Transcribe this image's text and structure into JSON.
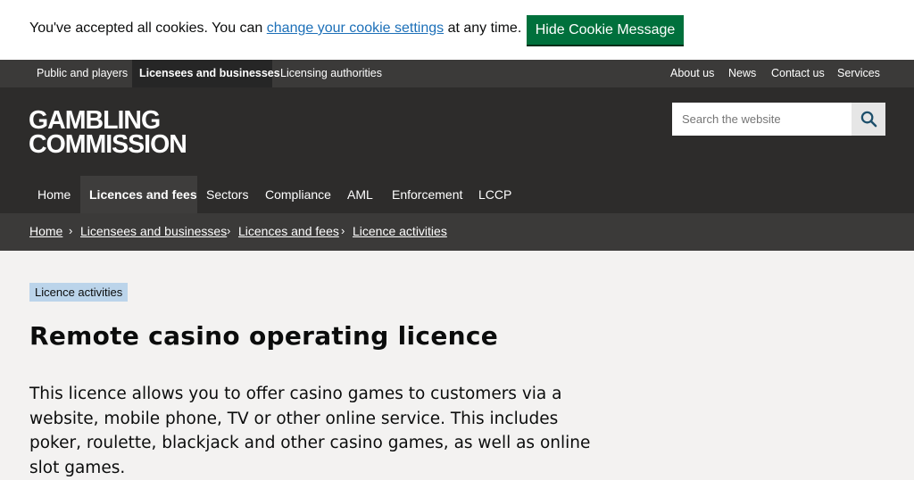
{
  "cookie": {
    "text_before": "You've accepted all cookies. You can ",
    "link_text": "change your cookie settings",
    "text_after": " at any time.",
    "button_label": "Hide Cookie Message"
  },
  "audience_nav": {
    "items": [
      {
        "label": "Public and players",
        "active": false
      },
      {
        "label": "Licensees and businesses",
        "active": true
      },
      {
        "label": "Licensing authorities",
        "active": false
      }
    ],
    "right_items": [
      {
        "label": "About us"
      },
      {
        "label": "News"
      },
      {
        "label": "Contact us"
      },
      {
        "label": "Services"
      }
    ]
  },
  "header": {
    "logo_line1": "GAMBLING",
    "logo_line2": "COMMISSION",
    "search_placeholder": "Search the website",
    "search_icon": "search-icon"
  },
  "main_nav": {
    "items": [
      {
        "label": "Home",
        "active": false
      },
      {
        "label": "Licences and fees",
        "active": true
      },
      {
        "label": "Sectors",
        "active": false
      },
      {
        "label": "Compliance",
        "active": false
      },
      {
        "label": "AML",
        "active": false
      },
      {
        "label": "Enforcement",
        "active": false
      },
      {
        "label": "LCCP",
        "active": false
      }
    ]
  },
  "breadcrumb": {
    "items": [
      {
        "label": "Home"
      },
      {
        "label": "Licensees and businesses"
      },
      {
        "label": "Licences and fees"
      },
      {
        "label": "Licence activities"
      }
    ],
    "separator": "›"
  },
  "content": {
    "tag": "Licence activities",
    "title": "Remote casino operating licence",
    "lead": "This licence allows you to offer casino games to customers via a website, mobile phone, TV or other online service. This includes poker, roulette, blackjack and other casino games, as well as online slot games."
  },
  "colors": {
    "cookie_button": "#00703c",
    "link": "#1d70b8",
    "header_bg": "#2d2c2b",
    "bar_bg": "#3b3a39",
    "tag_bg": "#bbd4ea",
    "page_bg": "#f3f2f1"
  }
}
